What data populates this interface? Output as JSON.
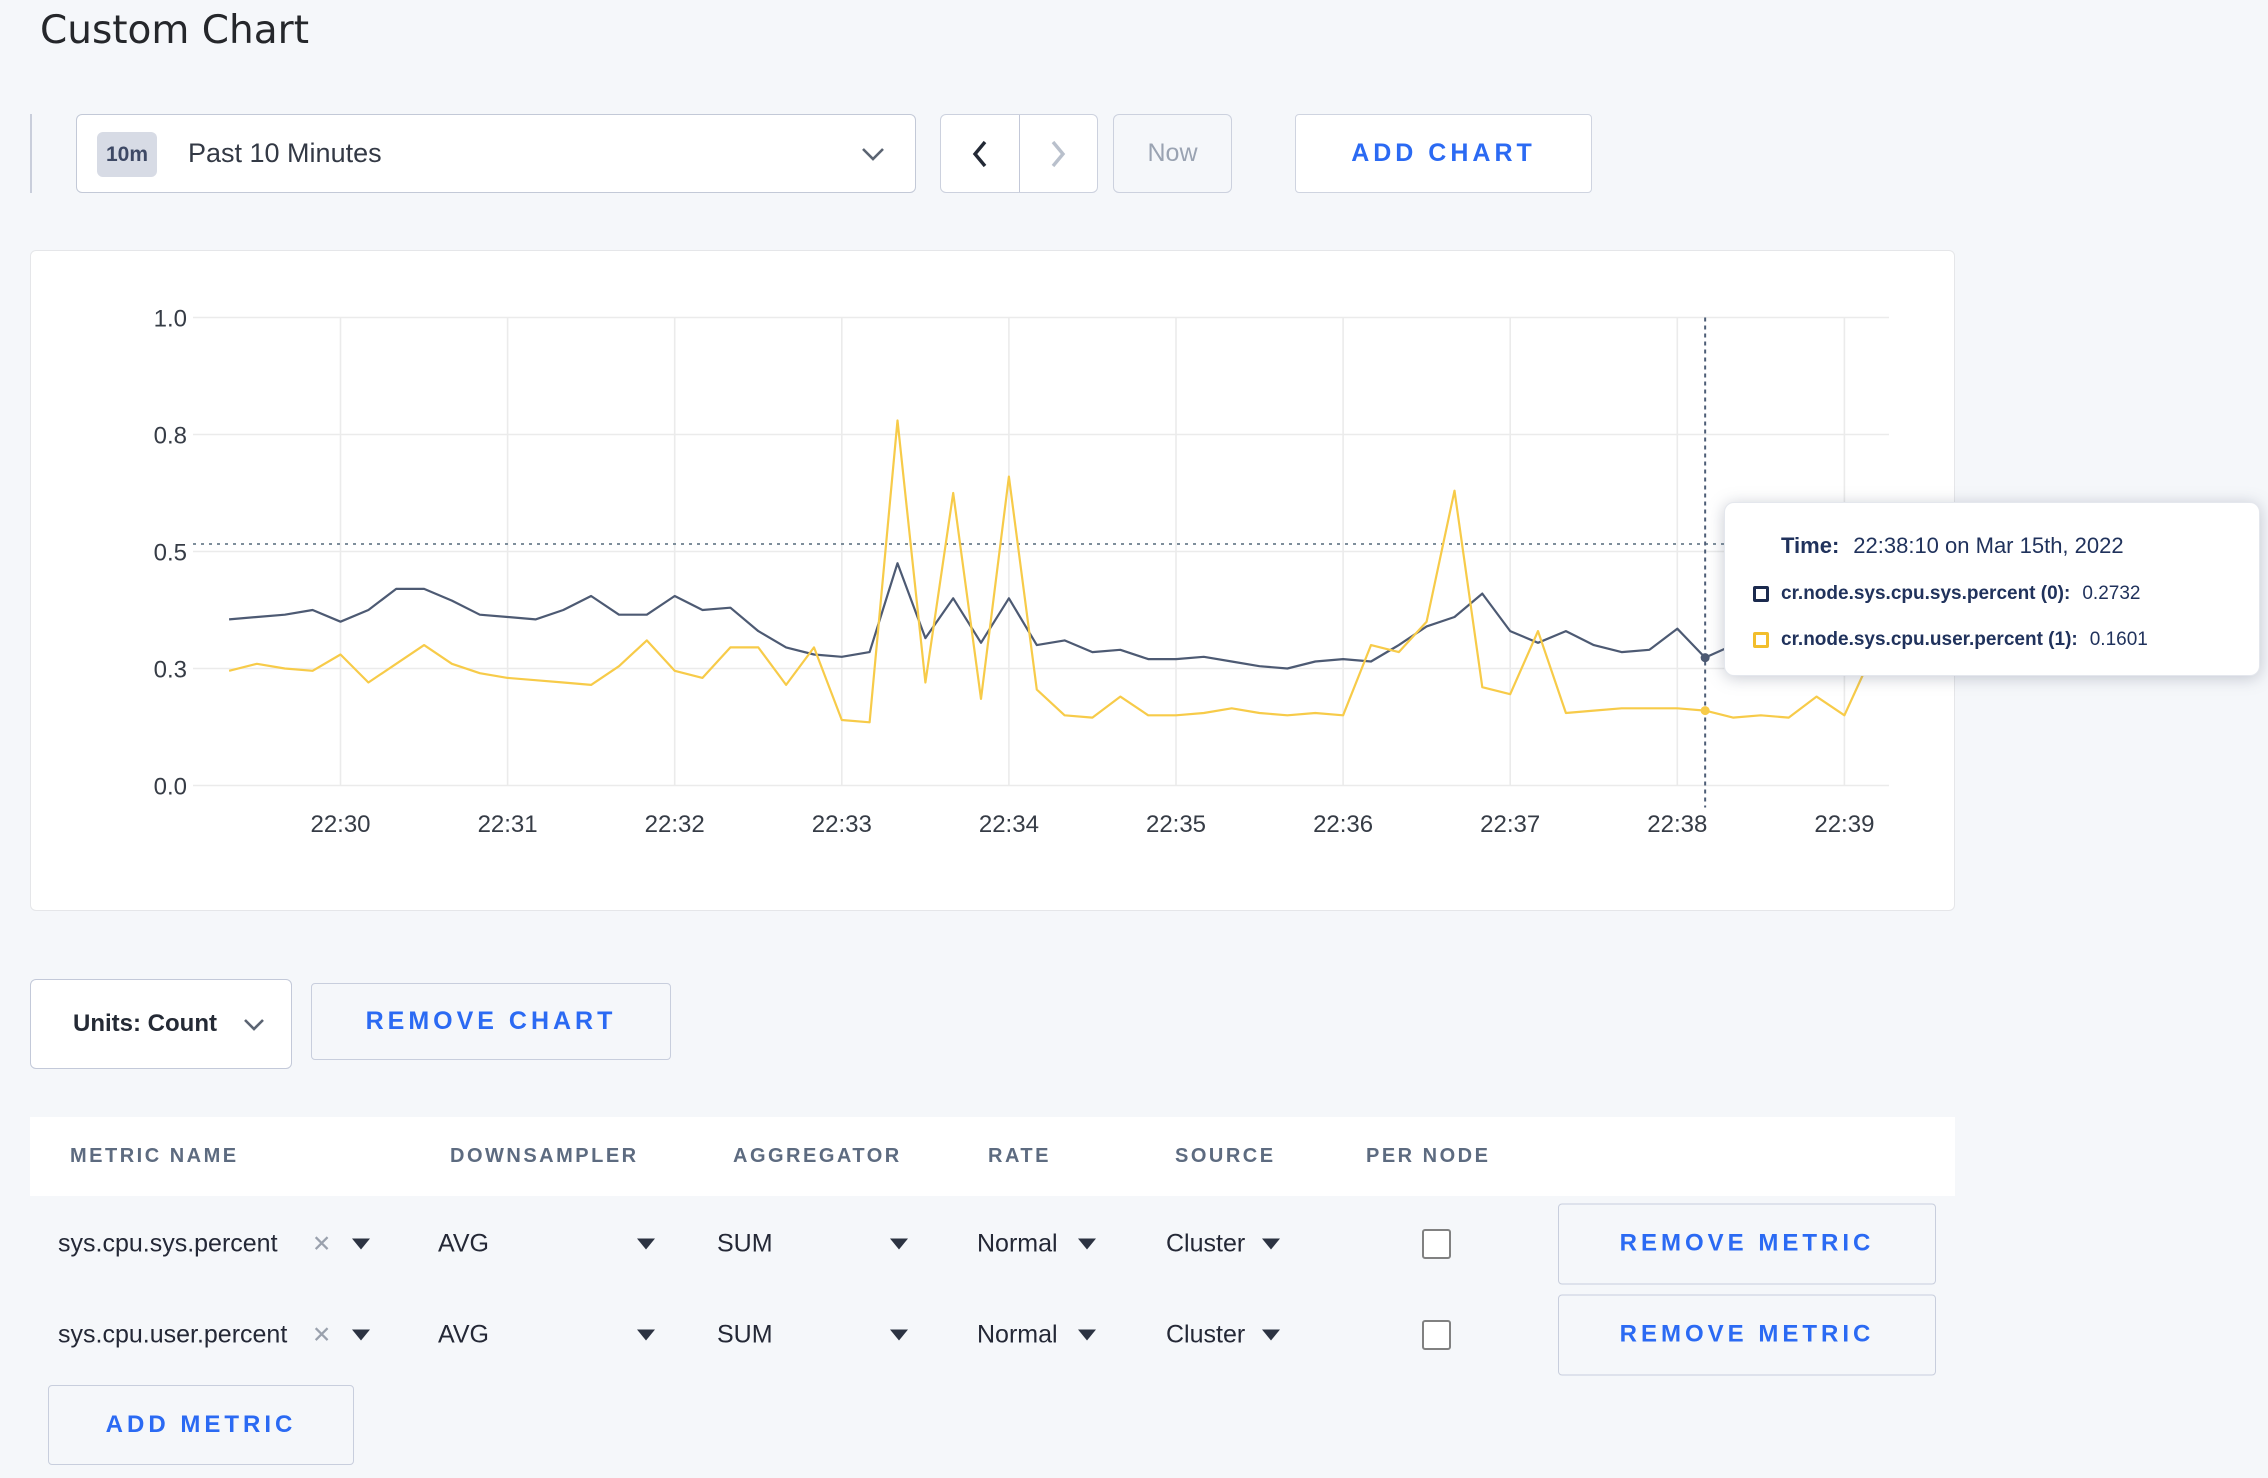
{
  "page": {
    "title": "Custom Chart"
  },
  "toolbar": {
    "range_badge": "10m",
    "range_label": "Past 10 Minutes",
    "now_label": "Now",
    "add_chart_label": "ADD CHART"
  },
  "chart_controls": {
    "units_label": "Units: Count",
    "remove_chart_label": "REMOVE CHART",
    "add_metric_label": "ADD METRIC"
  },
  "icons": {
    "clear": "✕"
  },
  "tooltip": {
    "time_label": "Time:",
    "time_value": "22:38:10 on Mar 15th, 2022",
    "rows": [
      {
        "name": "cr.node.sys.cpu.sys.percent (0):",
        "value": "0.2732",
        "color": "#1b2a4e"
      },
      {
        "name": "cr.node.sys.cpu.user.percent (1):",
        "value": "0.1601",
        "color": "#f2be2c"
      }
    ]
  },
  "metrics_table": {
    "headers": [
      "METRIC NAME",
      "DOWNSAMPLER",
      "AGGREGATOR",
      "RATE",
      "SOURCE",
      "PER NODE"
    ],
    "remove_metric_label": "REMOVE METRIC",
    "rows": [
      {
        "name": "sys.cpu.sys.percent",
        "downsampler": "AVG",
        "aggregator": "SUM",
        "rate": "Normal",
        "source": "Cluster",
        "per_node": false
      },
      {
        "name": "sys.cpu.user.percent",
        "downsampler": "AVG",
        "aggregator": "SUM",
        "rate": "Normal",
        "source": "Cluster",
        "per_node": false
      }
    ]
  },
  "chart_data": {
    "type": "line",
    "title": "",
    "xlabel": "",
    "ylabel": "",
    "ylim": [
      0,
      1
    ],
    "grid": true,
    "legend_position": "none",
    "y_ticks": [
      {
        "label": "1.0",
        "value": 1.0
      },
      {
        "label": "0.8",
        "value": 0.75
      },
      {
        "label": "0.5",
        "value": 0.5
      },
      {
        "label": "0.3",
        "value": 0.25
      },
      {
        "label": "0.0",
        "value": 0.0
      }
    ],
    "x_ticks": [
      "22:30",
      "22:31",
      "22:32",
      "22:33",
      "22:34",
      "22:35",
      "22:36",
      "22:37",
      "22:38",
      "22:39"
    ],
    "x_tick_seconds": [
      0,
      60,
      120,
      180,
      240,
      300,
      360,
      420,
      480,
      540
    ],
    "seconds": [
      -40,
      -30,
      -20,
      -10,
      0,
      10,
      20,
      30,
      40,
      50,
      60,
      70,
      80,
      90,
      100,
      110,
      120,
      130,
      140,
      150,
      160,
      170,
      180,
      190,
      200,
      210,
      220,
      230,
      240,
      250,
      260,
      270,
      280,
      290,
      300,
      310,
      320,
      330,
      340,
      350,
      360,
      370,
      380,
      390,
      400,
      410,
      420,
      430,
      440,
      450,
      460,
      470,
      480,
      490,
      500,
      510,
      520,
      530,
      540,
      550
    ],
    "series": [
      {
        "name": "cr.node.sys.cpu.sys.percent",
        "color": "#4d5a73",
        "values": [
          0.355,
          0.36,
          0.365,
          0.375,
          0.35,
          0.375,
          0.42,
          0.42,
          0.395,
          0.365,
          0.36,
          0.355,
          0.375,
          0.405,
          0.365,
          0.365,
          0.405,
          0.375,
          0.38,
          0.33,
          0.295,
          0.28,
          0.275,
          0.285,
          0.475,
          0.315,
          0.4,
          0.305,
          0.4,
          0.3,
          0.31,
          0.285,
          0.29,
          0.27,
          0.27,
          0.275,
          0.265,
          0.255,
          0.25,
          0.265,
          0.27,
          0.265,
          0.3,
          0.34,
          0.36,
          0.41,
          0.33,
          0.305,
          0.33,
          0.3,
          0.285,
          0.29,
          0.335,
          0.2732,
          0.3,
          0.31,
          0.3,
          0.305,
          0.3,
          0.3
        ]
      },
      {
        "name": "cr.node.sys.cpu.user.percent",
        "color": "#f7cb49",
        "values": [
          0.245,
          0.26,
          0.25,
          0.245,
          0.28,
          0.22,
          0.26,
          0.3,
          0.26,
          0.24,
          0.23,
          0.225,
          0.22,
          0.215,
          0.255,
          0.31,
          0.245,
          0.23,
          0.295,
          0.295,
          0.215,
          0.295,
          0.14,
          0.135,
          0.78,
          0.22,
          0.625,
          0.185,
          0.66,
          0.205,
          0.15,
          0.145,
          0.19,
          0.15,
          0.15,
          0.155,
          0.165,
          0.155,
          0.15,
          0.155,
          0.15,
          0.3,
          0.285,
          0.35,
          0.63,
          0.21,
          0.195,
          0.33,
          0.155,
          0.16,
          0.165,
          0.165,
          0.165,
          0.1601,
          0.145,
          0.15,
          0.145,
          0.19,
          0.15,
          0.28
        ]
      }
    ],
    "hover": {
      "second": 490,
      "time": "22:38:10 on Mar 15th, 2022",
      "guide_value": 0.516,
      "values": [
        0.2732,
        0.1601
      ]
    }
  }
}
